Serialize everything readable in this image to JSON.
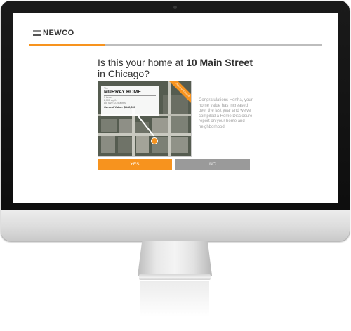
{
  "brand": {
    "logo_text": "NEWCO"
  },
  "progress": {
    "fraction": 0.26
  },
  "question": {
    "prefix": "Is this your home at ",
    "address": "10 Main Street",
    "suffix": " in Chicago?"
  },
  "card": {
    "label_small": "The",
    "home_name": "MURRAY HOME",
    "detail_lines": [
      "3 beds",
      "2,000 sq. ft.",
      "Lot Size: 0.25 acres"
    ],
    "current_value": "Current Value: $342,000",
    "ribbon_text": "Home Disclosure"
  },
  "message": "Congratulations Hertha, your home value has increased over the last year and we've compiled a Home Disclosure report on your home and neighborhood.",
  "buttons": {
    "yes": "YES",
    "no": "NO"
  },
  "colors": {
    "accent": "#f7931e",
    "secondary": "#9a9a9a"
  },
  "icons": {
    "logo": "newco-logo-icon",
    "pin": "location-pin-icon"
  }
}
